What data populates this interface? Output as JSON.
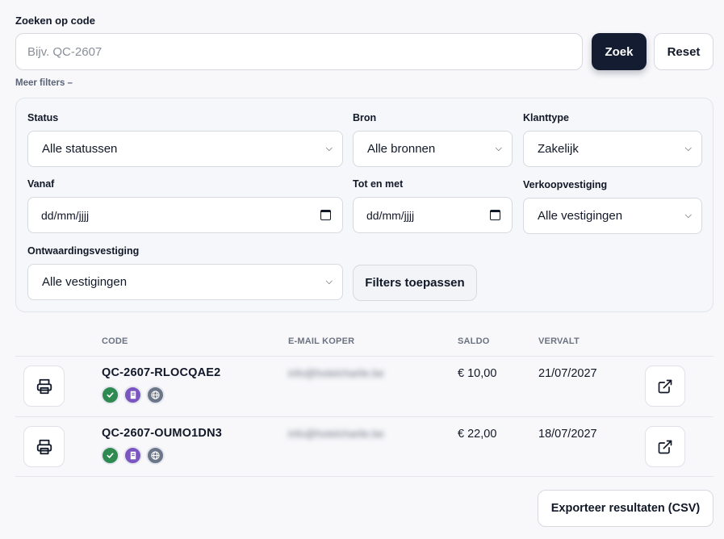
{
  "search": {
    "label": "Zoeken op code",
    "placeholder": "Bijv. QC-2607",
    "value": "",
    "search_button": "Zoek",
    "reset_button": "Reset",
    "more_filters_link": "Meer filters –"
  },
  "filters": {
    "status": {
      "label": "Status",
      "value": "Alle statussen"
    },
    "bron": {
      "label": "Bron",
      "value": "Alle bronnen"
    },
    "klanttype": {
      "label": "Klanttype",
      "value": "Zakelijk"
    },
    "vanaf": {
      "label": "Vanaf",
      "value": "dd/mm/jjjj"
    },
    "tot_en_met": {
      "label": "Tot en met",
      "value": "dd/mm/jjjj"
    },
    "verkoopvestiging": {
      "label": "Verkoopvestiging",
      "value": "Alle vestigingen"
    },
    "ontwaardingsvestiging": {
      "label": "Ontwaardingsvestiging",
      "value": "Alle vestigingen"
    },
    "apply_button": "Filters toepassen"
  },
  "table": {
    "columns": [
      "CODE",
      "E-MAIL KOPER",
      "SALDO",
      "VERVALT"
    ],
    "rows": [
      {
        "code": "QC-2607-RLOCQAE2",
        "email": "info@hotelcharlie.be",
        "saldo": "€ 10,00",
        "vervalt": "21/07/2027"
      },
      {
        "code": "QC-2607-OUMO1DN3",
        "email": "info@hotelcharlie.be",
        "saldo": "€ 22,00",
        "vervalt": "18/07/2027"
      }
    ]
  },
  "icons": {
    "print": "printer-icon",
    "open": "external-link-icon",
    "badges": [
      "check-circle-icon",
      "receipt-icon",
      "globe-icon"
    ]
  },
  "colors": {
    "primary_button": "#131c30",
    "badge_green": "#2f8a52",
    "badge_purple": "#7b56c0",
    "badge_gray": "#6b7788"
  },
  "export_button": "Exporteer resultaten (CSV)"
}
